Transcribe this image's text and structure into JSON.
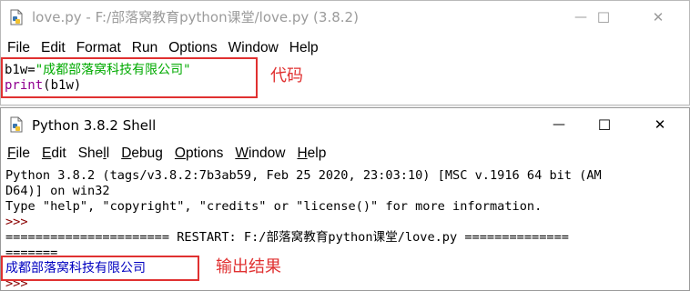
{
  "editor": {
    "title": "love.py - F:/部落窝教育python课堂/love.py (3.8.2)",
    "window_controls": {
      "minimize": "—",
      "maximize": "☐",
      "close": "✕"
    },
    "menu": [
      "File",
      "Edit",
      "Format",
      "Run",
      "Options",
      "Window",
      "Help"
    ],
    "code": {
      "line1_var": "b1w=",
      "line1_string": "\"成都部落窝科技有限公司\"",
      "line2_builtin": "print",
      "line2_rest": "(b1w)"
    },
    "annotation": "代码"
  },
  "shell": {
    "title": "Python 3.8.2 Shell",
    "window_controls": {
      "minimize": "—",
      "maximize": "☐",
      "close": "✕"
    },
    "menu": [
      {
        "label": "File",
        "underline": "F",
        "rest": "ile"
      },
      {
        "label": "Edit",
        "underline": "E",
        "rest": "dit"
      },
      {
        "label": "Shell",
        "pre": "She",
        "underline": "l",
        "rest": "l"
      },
      {
        "label": "Debug",
        "underline": "D",
        "rest": "ebug"
      },
      {
        "label": "Options",
        "underline": "O",
        "rest": "ptions"
      },
      {
        "label": "Window",
        "underline": "W",
        "rest": "indow"
      },
      {
        "label": "Help",
        "underline": "H",
        "rest": "elp"
      }
    ],
    "output": {
      "banner_line1": "Python 3.8.2 (tags/v3.8.2:7b3ab59, Feb 25 2020, 23:03:10) [MSC v.1916 64 bit (AM",
      "banner_line2": "D64)] on win32",
      "banner_line3": "Type \"help\", \"copyright\", \"credits\" or \"license()\" for more information.",
      "prompt1": ">>>",
      "restart_line": "====================== RESTART: F:/部落窝教育python课堂/love.py ==============",
      "restart_tail": "=======",
      "program_output": "成都部落窝科技有限公司",
      "prompt2": ">>>"
    },
    "annotation": "输出结果"
  },
  "colors": {
    "annotation": "#e03131",
    "string": "#00aa00",
    "builtin": "#900090",
    "stdout": "#0000c0",
    "prompt": "#8b0000"
  },
  "icons": [
    "idle-file-icon",
    "python-shell-icon",
    "minimize-icon",
    "maximize-icon",
    "close-icon"
  ]
}
